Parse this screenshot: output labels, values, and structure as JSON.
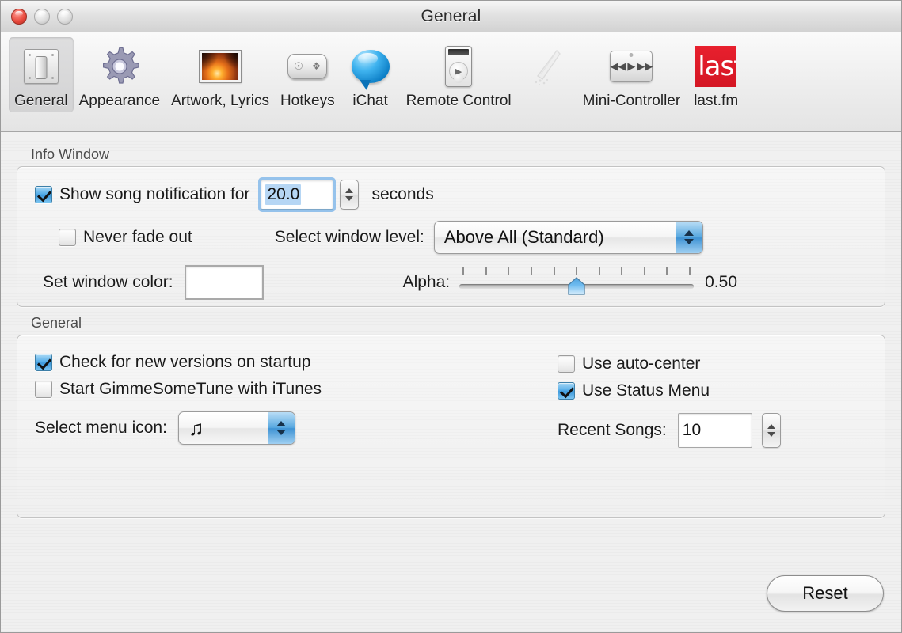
{
  "window": {
    "title": "General",
    "controls": {
      "close": "close",
      "minimize": "minimize",
      "zoom": "zoom"
    }
  },
  "toolbar": {
    "items": [
      {
        "label": "General",
        "icon": "light-switch-icon",
        "selected": true
      },
      {
        "label": "Appearance",
        "icon": "gear-icon",
        "selected": false
      },
      {
        "label": "Artwork, Lyrics",
        "icon": "photo-thumbnail-icon",
        "selected": false
      },
      {
        "label": "Hotkeys",
        "icon": "keyboard-keys-icon",
        "selected": false
      },
      {
        "label": "iChat",
        "icon": "chat-bubble-icon",
        "selected": false
      },
      {
        "label": "Remote Control",
        "icon": "ipod-icon",
        "selected": false
      },
      {
        "label": "",
        "icon": "sparkle-wand-icon",
        "selected": false
      },
      {
        "label": "Mini-Controller",
        "icon": "mini-controller-icon",
        "selected": false
      },
      {
        "label": "last.fm",
        "icon": "lastfm-logo-icon",
        "selected": false
      }
    ]
  },
  "info_window": {
    "group_title": "Info Window",
    "show_song_notification": {
      "label": "Show song notification for",
      "checked": true,
      "value": "20.0",
      "value_selected": true,
      "unit_label": "seconds",
      "stepper": "stepper"
    },
    "never_fade_out": {
      "label": "Never fade out",
      "checked": false
    },
    "window_level": {
      "label": "Select window level:",
      "selected": "Above All (Standard)",
      "options": [
        "Above All (Standard)"
      ]
    },
    "window_color": {
      "label": "Set window color:",
      "color": "#000000"
    },
    "alpha": {
      "label": "Alpha:",
      "value": "0.50",
      "min": 0,
      "max": 1,
      "position_percent": 50,
      "tick_count": 11
    }
  },
  "general": {
    "group_title": "General",
    "check_for_new_versions": {
      "label": "Check for new versions on startup",
      "checked": true
    },
    "start_with_itunes": {
      "label": "Start GimmeSomeTune with iTunes",
      "checked": false
    },
    "menu_icon": {
      "label": "Select menu icon:",
      "selected": "♫",
      "options": [
        "♫"
      ]
    },
    "use_auto_center": {
      "label": "Use auto-center",
      "checked": false
    },
    "use_status_menu": {
      "label": "Use Status Menu",
      "checked": true
    },
    "recent_songs": {
      "label": "Recent Songs:",
      "value": "10",
      "stepper": "stepper"
    }
  },
  "footer": {
    "reset_label": "Reset"
  },
  "colors": {
    "accent_blue": "#3f93d4",
    "window_color_swatch": "#000000",
    "lastfm_red": "#d41623",
    "close_button_red": "#e8493c"
  }
}
